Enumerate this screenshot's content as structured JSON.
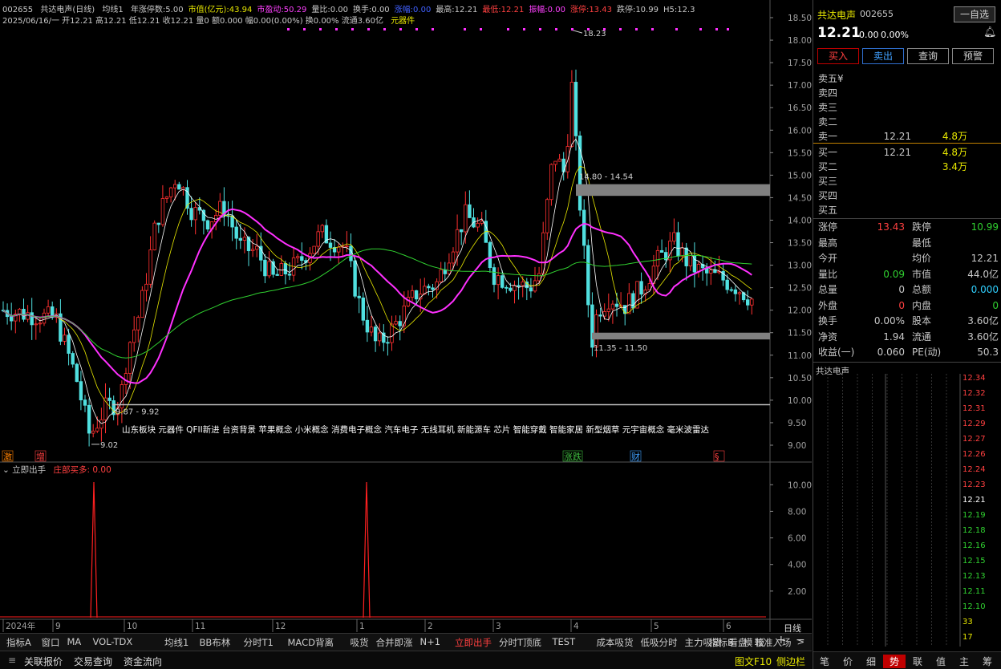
{
  "header": {
    "code": "002655",
    "name_period": "共达电声(日线)",
    "ma_label": "均线1",
    "items": [
      {
        "k": "年涨停数:",
        "v": "5.00",
        "c": "#c8c8c8"
      },
      {
        "k": "市值(亿元):",
        "v": "43.94",
        "c": "#e8e800"
      },
      {
        "k": "市盈动:",
        "v": "50.29",
        "c": "#ff40ff"
      },
      {
        "k": "量比:",
        "v": "0.00",
        "c": "#c8c8c8"
      },
      {
        "k": "换手:",
        "v": "0.00",
        "c": "#c8c8c8"
      },
      {
        "k": "涨幅:",
        "v": "0.00",
        "c": "#4060ff"
      },
      {
        "k": "最高:",
        "v": "12.21",
        "c": "#c8c8c8"
      },
      {
        "k": "最低:",
        "v": "12.21",
        "c": "#ff4040"
      },
      {
        "k": "振幅:",
        "v": "0.00",
        "c": "#ff40ff"
      },
      {
        "k": "涨停:",
        "v": "13.43",
        "c": "#ff4040"
      },
      {
        "k": "跌停:",
        "v": "10.99",
        "c": "#c8c8c8"
      },
      {
        "k": "H5:",
        "v": "12.3",
        "c": "#c8c8c8"
      }
    ],
    "line2": "2025/06/16/一 开12.21 高12.21 低12.21 收12.21 量0 额0.000 幅0.00(0.00%) 换0.00% 流通3.60亿",
    "line2_tag": "元器件"
  },
  "chart_data": {
    "type": "candlestick",
    "title": "共达电声(日线)",
    "ylim": [
      8.8,
      18.6
    ],
    "y_ticks": [
      "18.50",
      "18.00",
      "17.50",
      "17.00",
      "16.50",
      "16.00",
      "15.50",
      "15.00",
      "14.50",
      "14.00",
      "13.50",
      "13.00",
      "12.50",
      "12.00",
      "11.50",
      "11.00",
      "10.50",
      "10.00",
      "9.50",
      "9.00"
    ],
    "x_months": [
      "2024年",
      "9",
      "10",
      "11",
      "12",
      "1",
      "2",
      "3",
      "4",
      "5",
      "6"
    ],
    "annotations": {
      "high": "18.23",
      "low": "9.02",
      "zone1": "14.80 - 14.54",
      "zone2": "11.35 - 11.50",
      "zone3": "9.87 - 9.92"
    },
    "concepts": "山东板块 元器件 QFII新进 台资背景 苹果概念 小米概念 消费电子概念 汽车电子 无线耳机 新能源车 芯片 智能穿戴 智能家居 新型烟草 元宇宙概念 毫米波雷达",
    "markers": [
      {
        "label": "激",
        "color": "#ff8000"
      },
      {
        "label": "增",
        "color": "#ff4040"
      },
      {
        "label": "涨跌",
        "color": "#40c040"
      },
      {
        "label": "财",
        "color": "#40a0ff"
      },
      {
        "label": "§",
        "color": "#ff4040"
      }
    ]
  },
  "indicator": {
    "name": "立即出手",
    "sub": "庄部买多: 0.00",
    "y_ticks": [
      "10.00",
      "8.00",
      "6.00",
      "4.00",
      "2.00"
    ]
  },
  "bottom_tabs": [
    "指标A",
    "窗口",
    "MA",
    "VOL-TDX",
    "均线1",
    "BB布林",
    "分时T1",
    "MACD背离",
    "吸货",
    "合并即涨",
    "N+1",
    "立即出手",
    "分时T顶底",
    "TEST",
    "成本吸货",
    "低吸分时",
    "主力吸货",
    "看盘",
    "较准入场",
    "指标B",
    "模",
    "板"
  ],
  "bottom_active": "立即出手",
  "date_button": "日线",
  "status_bar": [
    "关联报价",
    "交易查询",
    "资金流向",
    "图文F10",
    "侧边栏"
  ],
  "right": {
    "name": "共达电声",
    "code": "002655",
    "price": "12.21",
    "change": "0.00",
    "pct": "0.00%",
    "watch_btn": "一自选",
    "buttons": [
      "买入",
      "卖出",
      "查询",
      "预警"
    ],
    "sells": [
      {
        "l": "卖五¥",
        "p": "",
        "v": ""
      },
      {
        "l": "卖四",
        "p": "",
        "v": ""
      },
      {
        "l": "卖三",
        "p": "",
        "v": ""
      },
      {
        "l": "卖二",
        "p": "",
        "v": ""
      },
      {
        "l": "卖一",
        "p": "12.21",
        "v": "4.8万"
      }
    ],
    "buys": [
      {
        "l": "买一",
        "p": "12.21",
        "v": "4.8万"
      },
      {
        "l": "买二",
        "p": "",
        "v": "3.4万"
      },
      {
        "l": "买三",
        "p": "",
        "v": ""
      },
      {
        "l": "买四",
        "p": "",
        "v": ""
      },
      {
        "l": "买五",
        "p": "",
        "v": ""
      }
    ],
    "stats": [
      [
        {
          "k": "涨停",
          "v": "13.43",
          "c": "#ff4040"
        },
        {
          "k": "跌停",
          "v": "10.99",
          "c": "#30d030"
        }
      ],
      [
        {
          "k": "最高",
          "v": "",
          "c": "#c8c8c8"
        },
        {
          "k": "最低",
          "v": "",
          "c": "#c8c8c8"
        }
      ],
      [
        {
          "k": "今开",
          "v": "",
          "c": "#c8c8c8"
        },
        {
          "k": "均价",
          "v": "12.21",
          "c": "#c8c8c8"
        }
      ],
      [
        {
          "k": "量比",
          "v": "0.09",
          "c": "#30d030"
        },
        {
          "k": "市值",
          "v": "44.0亿",
          "c": "#c8c8c8"
        }
      ],
      [
        {
          "k": "总量",
          "v": "0",
          "c": "#c8c8c8"
        },
        {
          "k": "总额",
          "v": "0.000",
          "c": "#30d0ff"
        }
      ],
      [
        {
          "k": "外盘",
          "v": "0",
          "c": "#ff4040"
        },
        {
          "k": "内盘",
          "v": "0",
          "c": "#30d030"
        }
      ],
      [
        {
          "k": "换手",
          "v": "0.00%",
          "c": "#c8c8c8"
        },
        {
          "k": "股本",
          "v": "3.60亿",
          "c": "#c8c8c8"
        }
      ],
      [
        {
          "k": "净资",
          "v": "1.94",
          "c": "#c8c8c8"
        },
        {
          "k": "流通",
          "v": "3.60亿",
          "c": "#c8c8c8"
        }
      ],
      [
        {
          "k": "收益(一)",
          "v": "0.060",
          "c": "#c8c8c8"
        },
        {
          "k": "PE(动)",
          "v": "50.3",
          "c": "#c8c8c8"
        }
      ]
    ],
    "mini_title": "共达电声",
    "mini_ticks": [
      {
        "v": "12.34",
        "c": "#ff4040"
      },
      {
        "v": "12.32",
        "c": "#ff4040"
      },
      {
        "v": "12.31",
        "c": "#ff4040"
      },
      {
        "v": "12.29",
        "c": "#ff4040"
      },
      {
        "v": "12.27",
        "c": "#ff4040"
      },
      {
        "v": "12.26",
        "c": "#ff4040"
      },
      {
        "v": "12.24",
        "c": "#ff4040"
      },
      {
        "v": "12.23",
        "c": "#ff4040"
      },
      {
        "v": "12.21",
        "c": "#ffffff"
      },
      {
        "v": "12.19",
        "c": "#30d030"
      },
      {
        "v": "12.18",
        "c": "#30d030"
      },
      {
        "v": "12.16",
        "c": "#30d030"
      },
      {
        "v": "12.15",
        "c": "#30d030"
      },
      {
        "v": "12.13",
        "c": "#30d030"
      },
      {
        "v": "12.11",
        "c": "#30d030"
      },
      {
        "v": "12.10",
        "c": "#30d030"
      },
      {
        "v": "33",
        "c": "#e8e800"
      },
      {
        "v": "17",
        "c": "#e8e800"
      }
    ],
    "tabs": [
      "笔",
      "价",
      "细",
      "势",
      "联",
      "值",
      "主",
      "筹"
    ],
    "active_tab": "势"
  }
}
